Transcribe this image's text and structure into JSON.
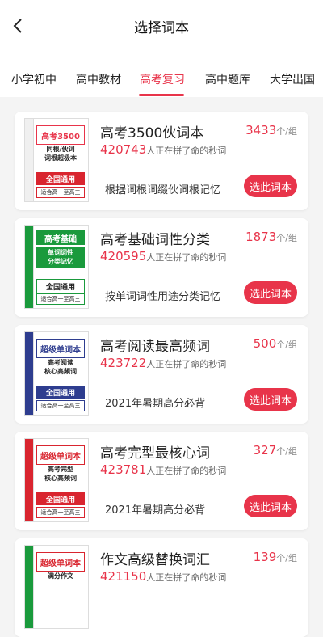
{
  "header": {
    "title": "选择词本"
  },
  "tabs": [
    {
      "label": "小学初中"
    },
    {
      "label": "高中教材"
    },
    {
      "label": "高考复习"
    },
    {
      "label": "高中题库"
    },
    {
      "label": "大学出国"
    }
  ],
  "active_tab": "高考复习",
  "colors": {
    "accent": "#e8344a"
  },
  "cards": [
    {
      "name": "高考3500伙词本",
      "price": "3433",
      "unit": "个/组",
      "count": "420743",
      "count_text": "人正在拼了命的秒词",
      "desc": "根据词根词缀伙词根记忆",
      "button": "选此词本",
      "cover": {
        "title": "高考3500",
        "sub": "同根/伙词\n词根超极本",
        "band": "全国通用",
        "foot": "适合高一至高三"
      }
    },
    {
      "name": "高考基础词性分类",
      "price": "1873",
      "unit": "个/组",
      "count": "420595",
      "count_text": "人正在拼了命的秒词",
      "desc": "按单词词性用途分类记忆",
      "button": "选此词本",
      "cover": {
        "title": "高考基础",
        "sub": "单词词性\n分类记忆",
        "band": "全国通用",
        "foot": "适合高一至高三"
      }
    },
    {
      "name": "高考阅读最高频词",
      "price": "500",
      "unit": "个/组",
      "count": "423722",
      "count_text": "人正在拼了命的秒词",
      "desc": "2021年暑期高分必背",
      "button": "选此词本",
      "cover": {
        "title": "超级单词本",
        "sub": "高考阅读\n核心高频词",
        "band": "全国通用",
        "foot": "适合高一至高三"
      }
    },
    {
      "name": "高考完型最核心词",
      "price": "327",
      "unit": "个/组",
      "count": "423781",
      "count_text": "人正在拼了命的秒词",
      "desc": "2021年暑期高分必背",
      "button": "选此词本",
      "cover": {
        "title": "超级单词本",
        "sub": "高考完型\n核心高频词",
        "band": "全国通用",
        "foot": "适合高一至高三"
      }
    },
    {
      "name": "作文高级替换词汇",
      "price": "139",
      "unit": "个/组",
      "count": "421150",
      "count_text": "人正在拼了命的秒词",
      "desc": "",
      "button": "",
      "cover": {
        "title": "超级单词本",
        "sub": "满分作文",
        "band": "",
        "foot": ""
      }
    }
  ]
}
